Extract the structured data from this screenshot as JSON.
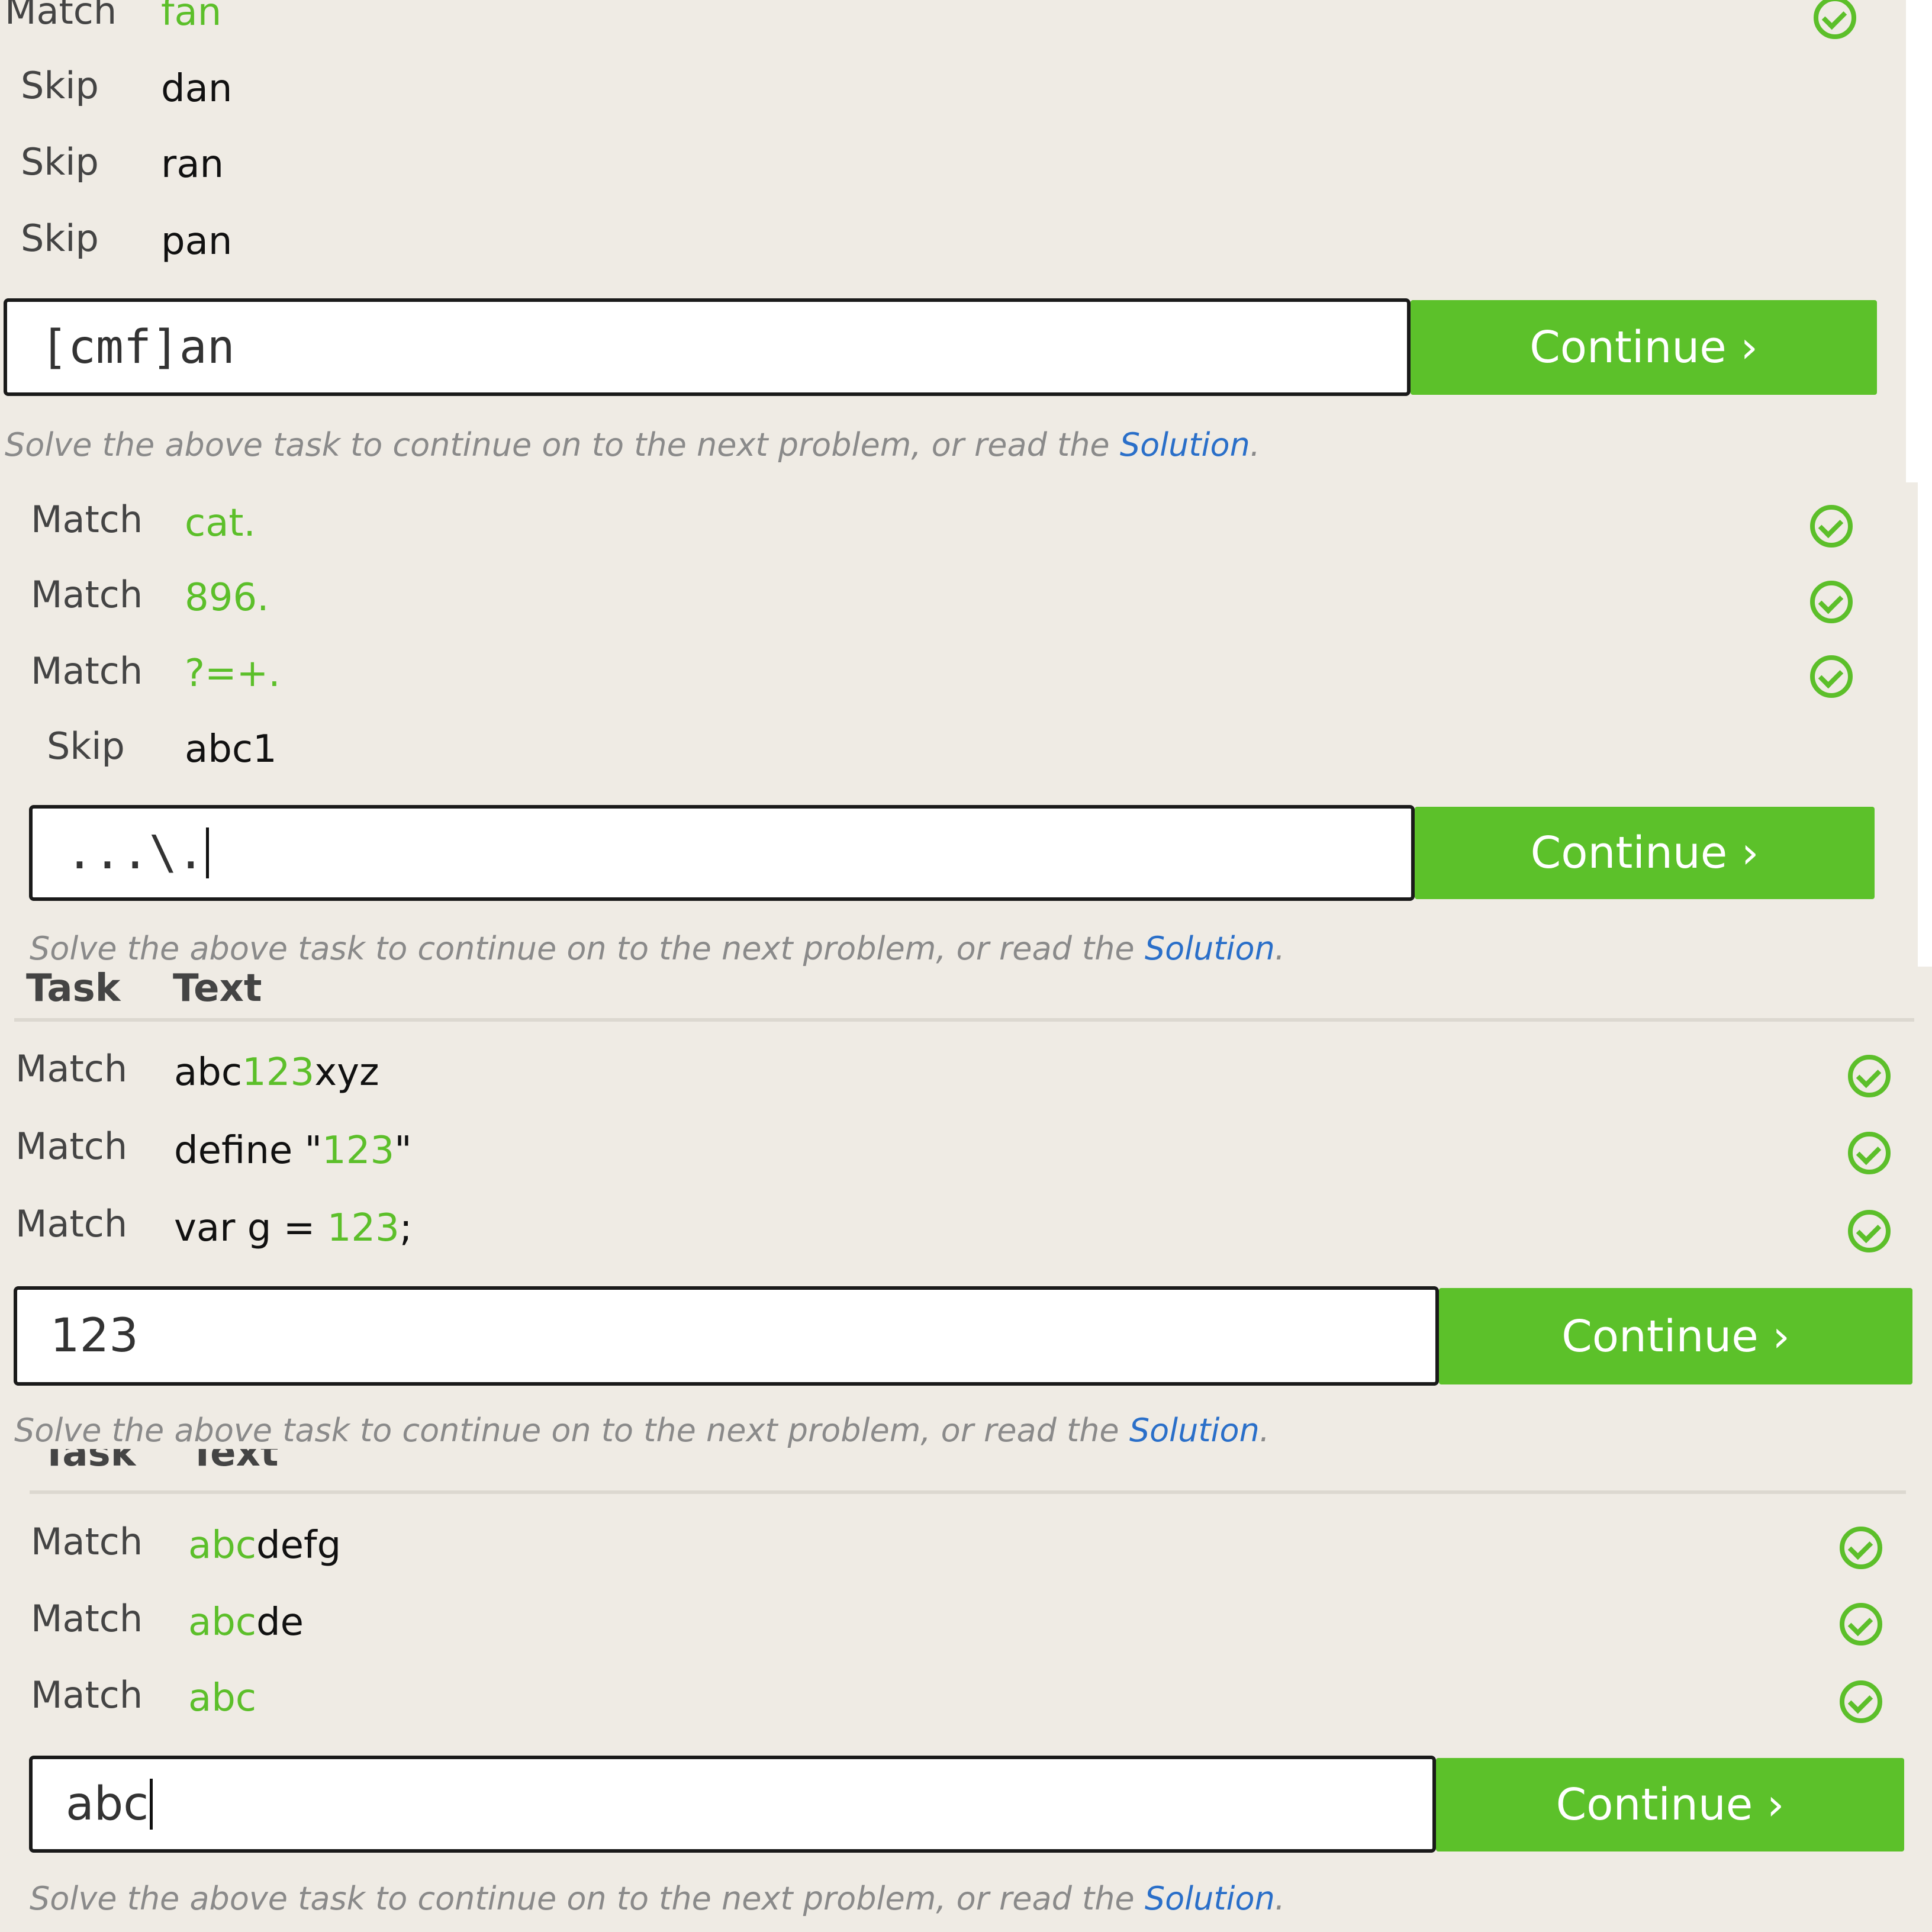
{
  "section1": {
    "rows": [
      {
        "task": "Match",
        "pre": "",
        "hl": "fan",
        "post": "",
        "check": true
      },
      {
        "task": "Skip",
        "pre": "dan",
        "hl": "",
        "post": "",
        "check": false
      },
      {
        "task": "Skip",
        "pre": "ran",
        "hl": "",
        "post": "",
        "check": false
      },
      {
        "task": "Skip",
        "pre": "pan",
        "hl": "",
        "post": "",
        "check": false
      }
    ],
    "input_value": "[cmf]an",
    "continue_label": "Continue ›",
    "note_text": "Solve the above task to continue on to the next problem, or read the ",
    "note_link": "Solution",
    "note_end": "."
  },
  "section2": {
    "rows": [
      {
        "task": "Match",
        "pre": "",
        "hl": "cat.",
        "post": "",
        "check": true
      },
      {
        "task": "Match",
        "pre": "",
        "hl": "896.",
        "post": "",
        "check": true
      },
      {
        "task": "Match",
        "pre": "",
        "hl": "?=+.",
        "post": "",
        "check": true
      },
      {
        "task": "Skip",
        "pre": "abc1",
        "hl": "",
        "post": "",
        "check": false
      }
    ],
    "input_value": "...\\.",
    "continue_label": "Continue ›",
    "note_text": "Solve the above task to continue on to the next problem, or read the ",
    "note_link": "Solution",
    "note_end": "."
  },
  "section3": {
    "header_task": "Task",
    "header_text": "Text",
    "rows": [
      {
        "task": "Match",
        "pre": "abc",
        "hl": "123",
        "post": "xyz",
        "check": true
      },
      {
        "task": "Match",
        "pre": "define \"",
        "hl": "123",
        "post": "\"",
        "check": true
      },
      {
        "task": "Match",
        "pre": "var g = ",
        "hl": "123",
        "post": ";",
        "check": true
      }
    ],
    "input_value": "123",
    "continue_label": "Continue ›",
    "note_text": "Solve the above task to continue on to the next problem, or read the ",
    "note_link": "Solution",
    "note_end": "."
  },
  "section4": {
    "header_task": "Task",
    "header_text": "Text",
    "rows": [
      {
        "task": "Match",
        "pre": "",
        "hl": "abc",
        "post": "defg",
        "check": true
      },
      {
        "task": "Match",
        "pre": "",
        "hl": "abc",
        "post": "de",
        "check": true
      },
      {
        "task": "Match",
        "pre": "",
        "hl": "abc",
        "post": "",
        "check": true
      }
    ],
    "input_value": "abc",
    "continue_label": "Continue ›",
    "note_text": "Solve the above task to continue on to the next problem, or read the ",
    "note_link": "Solution",
    "note_end": "."
  },
  "colors": {
    "background": "#efebe4",
    "match_highlight": "#5cbf2a",
    "button": "#5cc12a",
    "link": "#2a6fc9"
  }
}
